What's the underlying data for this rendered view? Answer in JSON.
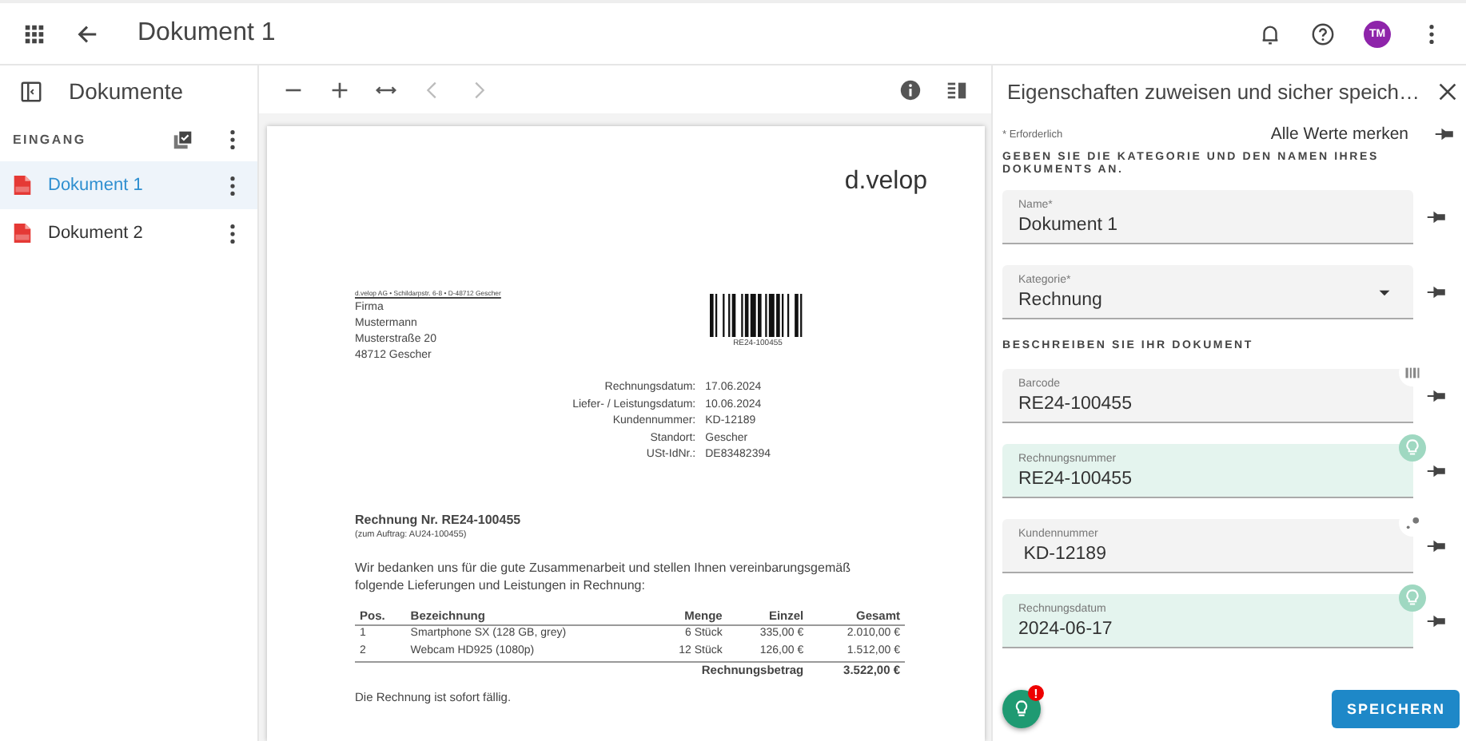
{
  "app_bar": {
    "title": "Dokument 1",
    "avatar": "TM"
  },
  "sidebar": {
    "title": "Dokumente",
    "section": "EINGANG",
    "items": [
      {
        "label": "Dokument 1",
        "selected": true
      },
      {
        "label": "Dokument 2",
        "selected": false
      }
    ]
  },
  "document": {
    "logo": "d.velop",
    "sender_line": "d.velop AG • Schildarpstr. 6-8 • D-48712 Gescher",
    "address": [
      "Firma",
      "Mustermann",
      "Musterstraße 20",
      "48712 Gescher"
    ],
    "barcode": "RE24-100455",
    "info": [
      {
        "label": "Rechnungsdatum:",
        "value": "17.06.2024"
      },
      {
        "label": "Liefer- / Leistungsdatum:",
        "value": "10.06.2024"
      },
      {
        "label": "Kundennummer:",
        "value": "KD-12189"
      },
      {
        "label": "Standort:",
        "value": "Gescher"
      },
      {
        "label": "USt-IdNr.:",
        "value": "DE83482394"
      }
    ],
    "title": "Rechnung Nr. RE24-100455",
    "subtitle": "(zum Auftrag: AU24-100455)",
    "intro": "Wir bedanken uns für die gute Zusammenarbeit und stellen Ihnen vereinbarungsgemäß folgende Lieferungen und Leistungen in Rechnung:",
    "table": {
      "columns": [
        "Pos.",
        "Bezeichnung",
        "Menge",
        "Einzel",
        "Gesamt"
      ],
      "rows": [
        [
          "1",
          "Smartphone SX (128 GB, grey)",
          "6 Stück",
          "335,00 €",
          "2.010,00 €"
        ],
        [
          "2",
          "Webcam HD925 (1080p)",
          "12 Stück",
          "126,00 €",
          "1.512,00 €"
        ]
      ],
      "total_label": "Rechnungsbetrag",
      "total": "3.522,00 €"
    },
    "footer": "Die Rechnung ist sofort fällig."
  },
  "panel": {
    "title": "Eigenschaften zuweisen und sicher speich…",
    "required_note": "* Erforderlich",
    "remember_all": "Alle Werte merken",
    "section_1": "GEBEN SIE DIE KATEGORIE UND DEN NAMEN IHRES DOKUMENTS AN.",
    "section_2": "BESCHREIBEN SIE IHR DOKUMENT",
    "fields_1": [
      {
        "kind": "text",
        "label": "Name*",
        "value": "Dokument 1",
        "highlighted": false
      },
      {
        "kind": "select",
        "label": "Kategorie*",
        "value": "Rechnung",
        "highlighted": false
      }
    ],
    "fields_2": [
      {
        "kind": "barcode",
        "label": "Barcode",
        "value": "RE24-100455",
        "highlighted": false
      },
      {
        "kind": "suggestion",
        "label": "Rechnungsnummer",
        "value": "RE24-100455",
        "highlighted": true
      },
      {
        "kind": "extracted",
        "label": "Kundennummer",
        "value": " KD-12189",
        "highlighted": false
      },
      {
        "kind": "suggestion",
        "label": "Rechnungsdatum",
        "value": "2024-06-17",
        "highlighted": true
      }
    ],
    "fab_badge": "!",
    "save_button": "SPEICHERN"
  }
}
